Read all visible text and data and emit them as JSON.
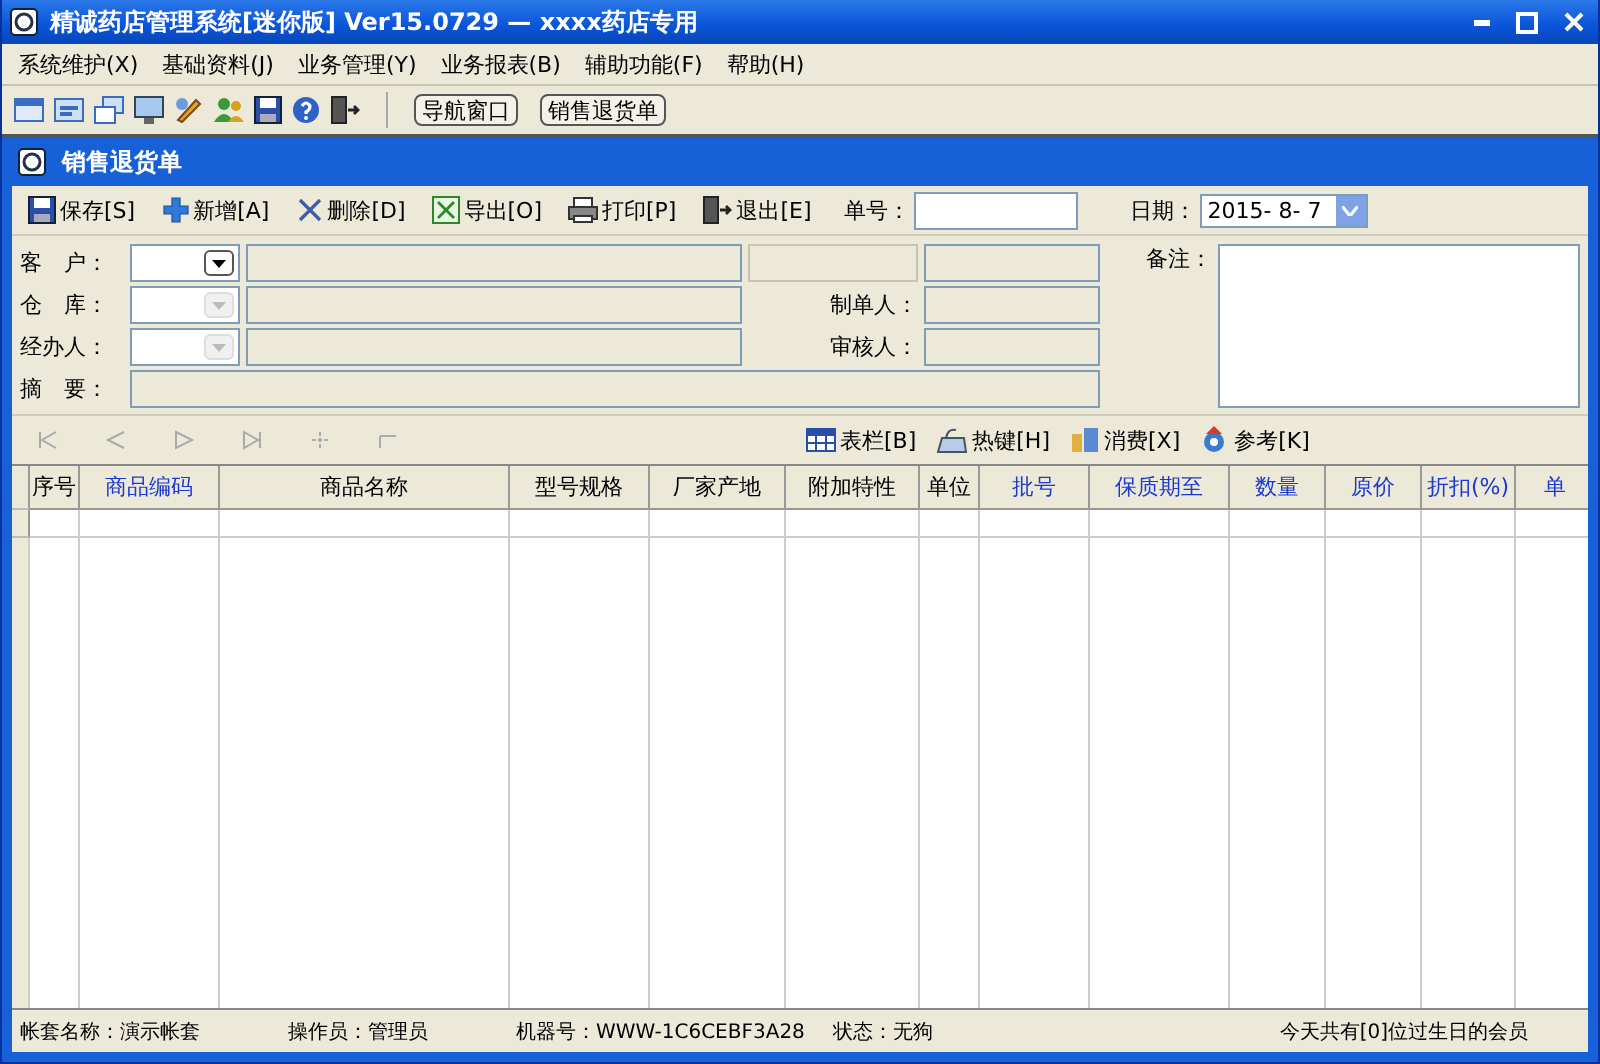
{
  "window": {
    "title": "精诚药店管理系统[迷你版] Ver15.0729 — xxxx药店专用"
  },
  "menu": [
    "系统维护(X)",
    "基础资料(J)",
    "业务管理(Y)",
    "业务报表(B)",
    "辅助功能(F)",
    "帮助(H)"
  ],
  "toolbar": {
    "buttons": [
      "导航窗口",
      "销售退货单"
    ]
  },
  "document": {
    "title": "销售退货单",
    "actions": [
      {
        "kind": "save",
        "label": "保存[S]"
      },
      {
        "kind": "add",
        "label": "新增[A]"
      },
      {
        "kind": "delete",
        "label": "删除[D]"
      },
      {
        "kind": "export",
        "label": "导出[O]"
      },
      {
        "kind": "print",
        "label": "打印[P]"
      },
      {
        "kind": "exit",
        "label": "退出[E]"
      }
    ],
    "number_label": "单号：",
    "date": {
      "label": "日期：",
      "value": "2015- 8- 7"
    },
    "fields": [
      {
        "label": "客　户：",
        "disabled": false
      },
      {
        "label": "仓　库：",
        "disabled": true
      },
      {
        "label": "经办人：",
        "disabled": true
      }
    ],
    "summary_label": "摘　要：",
    "maker_label": "制单人：",
    "reviewer_label": "审核人：",
    "remark_label": "备注：",
    "grid_tools": [
      {
        "kind": "columns",
        "label": "表栏[B]"
      },
      {
        "kind": "hotkey",
        "label": "热键[H]"
      },
      {
        "kind": "consume",
        "label": "消费[X]"
      },
      {
        "kind": "reference",
        "label": "参考[K]"
      }
    ]
  },
  "grid": {
    "columns": [
      {
        "label": "序号",
        "emphasized": false
      },
      {
        "label": "商品编码",
        "emphasized": true
      },
      {
        "label": "商品名称",
        "emphasized": false
      },
      {
        "label": "型号规格",
        "emphasized": false
      },
      {
        "label": "厂家产地",
        "emphasized": false
      },
      {
        "label": "附加特性",
        "emphasized": false
      },
      {
        "label": "单位",
        "emphasized": false
      },
      {
        "label": "批号",
        "emphasized": true
      },
      {
        "label": "保质期至",
        "emphasized": true
      },
      {
        "label": "数量",
        "emphasized": true
      },
      {
        "label": "原价",
        "emphasized": true
      },
      {
        "label": "折扣(%)",
        "emphasized": true
      },
      {
        "label": "单",
        "emphasized": true
      }
    ]
  },
  "status_bar": [
    "帐套名称：演示帐套",
    "操作员：管理员",
    "机器号：WWW-1C6CEBF3A28",
    "状态：无狗",
    "今天共有[0]位过生日的会员"
  ]
}
